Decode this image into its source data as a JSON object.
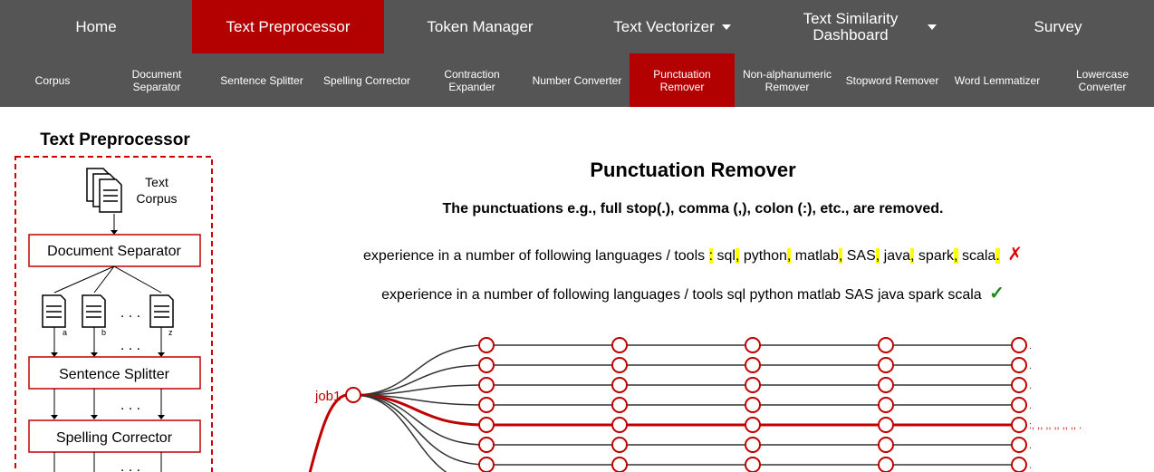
{
  "topnav": {
    "tabs": [
      {
        "label": "Home"
      },
      {
        "label": "Text Preprocessor",
        "active": true
      },
      {
        "label": "Token Manager"
      },
      {
        "label": "Text Vectorizer"
      },
      {
        "label": "Text Similarity Dashboard"
      },
      {
        "label": "Survey"
      }
    ]
  },
  "subnav": {
    "items": [
      {
        "label": "Corpus"
      },
      {
        "label": "Document Separator"
      },
      {
        "label": "Sentence Splitter"
      },
      {
        "label": "Spelling Corrector"
      },
      {
        "label": "Contraction Expander"
      },
      {
        "label": "Number Converter"
      },
      {
        "label": "Punctuation Remover",
        "active": true
      },
      {
        "label": "Non-alphanumeric Remover"
      },
      {
        "label": "Stopword Remover"
      },
      {
        "label": "Word Lemmatizer"
      },
      {
        "label": "Lowercase Converter"
      }
    ]
  },
  "diagram": {
    "title": "Text Preprocessor",
    "corpus_label": "Text Corpus",
    "steps": [
      "Document Separator",
      "Sentence Splitter",
      "Spelling Corrector"
    ],
    "doc_labels": [
      "a",
      "b",
      "z"
    ],
    "ellipsis": ". . ."
  },
  "main": {
    "title": "Punctuation Remover",
    "description": "The punctuations e.g., full stop(.), comma (,), colon (:), etc., are removed.",
    "example_before": {
      "parts": [
        "experience in a number of following languages / tools",
        ":",
        "sql",
        ",",
        "python",
        ",",
        "matlab",
        ",",
        "SAS",
        ",",
        "java",
        ",",
        "spark",
        ",",
        "scala",
        "."
      ],
      "mark": "✗"
    },
    "example_after": {
      "text": "experience in a number of following languages / tools sql python matlab SAS java spark scala",
      "mark": "✓"
    }
  },
  "graph": {
    "root_label": "job1",
    "row_end_labels": [
      ".",
      ".",
      ".",
      ".",
      ":, ,, ,, ,, ,, ,, .",
      ".",
      "."
    ],
    "highlight_row": 4,
    "colors": {
      "accent": "#c00000",
      "line": "#333333"
    }
  }
}
